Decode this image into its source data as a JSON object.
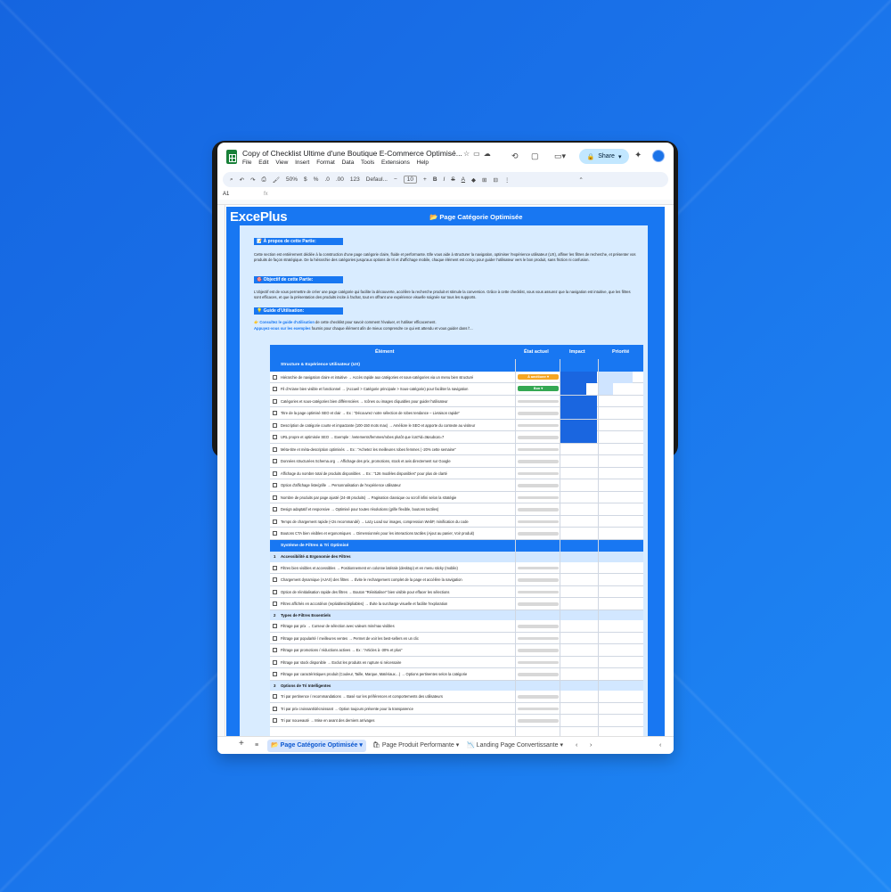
{
  "doc": {
    "title": "Copy of Checklist Ultime d'une Boutique E-Commerce Optimisé...",
    "menu": [
      "File",
      "Edit",
      "View",
      "Insert",
      "Format",
      "Data",
      "Tools",
      "Extensions",
      "Help"
    ],
    "share_label": "Share"
  },
  "toolbar": {
    "zoom": "50%",
    "currency": "$",
    "percent": "%",
    "dec_dec": ".0",
    "dec_inc": ".00",
    "number_format": "123",
    "font": "Defaul...",
    "font_size": "10",
    "bold": "B"
  },
  "formula_bar": {
    "cell": "A1",
    "fx": "fx"
  },
  "sheet": {
    "logo": "ExcePlus",
    "title": "📂 Page Catégorie Optimisée",
    "about_label": "📝 À propos de cette Partie:",
    "about_text": "Cette section est entièrement dédiée à la construction d'une page catégorie claire, fluide et performante. Elle vous aide à structurer la navigation, optimiser l'expérience utilisateur (UX), affiner les filtres de recherche, et présenter vos produits de façon stratégique. De la hiérarchie des catégories jusqu'aux options de tri et d'affichage mobile, chaque élément est conçu pour guider l'utilisateur vers le bon produit, sans friction ni confusion.",
    "objective_label": "🎯 Objectif de cette Partie:",
    "objective_text": "L'objectif est de vous permettre de créer une page catégorie qui facilite la découverte, accélère la recherche produit et stimule la conversion. Grâce à cette checklist, vous vous assurez que la navigation est intuitive, que les filtres sont efficaces, et que la présentation des produits incite à l'achat, tout en offrant une expérience visuelle soignée sur tous les supports.",
    "guide_label": "💡 Guide d'Utilisation:",
    "guide_line1_pre": "👉 ",
    "guide_line1_link": "Consultez le guide d'utilisation",
    "guide_line1_post": " de cette checklist pour savoir comment l'évaluer, et l'utiliser efficacement.",
    "guide_line2_link": "Appuyez-vous sur les exemples",
    "guide_line2_post": " fournis pour chaque élément afin de mieux comprendre ce qui est attendu et vous guider dans l'..."
  },
  "table": {
    "headers": {
      "element": "Élément",
      "etat": "État actuel",
      "impact": "Impact",
      "priorite": "Priorité"
    },
    "group1": "Structure & Expérience Utilisateur (UX)",
    "rows1": [
      {
        "text": "Hiérarchie de navigation claire et intuitive → Accès rapide aux catégories et sous-catégories via un menu bien structuré",
        "status": "À améliorer",
        "status_color": "#f5a623",
        "impact": 1.0,
        "priority": 0.95
      },
      {
        "text": "Fil d'Ariane bien visible et fonctionnel → (Accueil > Catégorie principale > Sous-catégorie) pour faciliter la navigation",
        "status": "Bon",
        "status_color": "#34a853",
        "impact": 0.7,
        "priority": 0.4
      },
      {
        "text": "Catégories et sous-catégories bien différenciées → Icônes ou images cliquables pour guider l'utilisateur",
        "status": "",
        "status_color": "",
        "impact": 1.0,
        "priority": 0
      },
      {
        "text": "Titre de la page optimisé SEO et clair → Ex : \"Découvrez notre sélection de robes tendance – Livraison rapide\"",
        "status": "",
        "status_color": "",
        "impact": 1.0,
        "priority": 0
      },
      {
        "text": "Description de catégorie courte et impactante (100-150 mots max) → Améliore le SEO et apporte du contexte au visiteur",
        "status": "",
        "status_color": "",
        "impact": 1.0,
        "priority": 0
      },
      {
        "text": "URL propre et optimisée SEO → Exemple : /vetements/femmes/robes plutôt que /cat?id=3&subcat=7",
        "status": "",
        "status_color": "",
        "impact": 1.0,
        "priority": 0
      },
      {
        "text": "Méta-titre et méta-description optimisés → Ex : \"Achetez les meilleures robes femmes | -20% cette semaine\"",
        "status": "",
        "status_color": "",
        "impact": 0,
        "priority": 0
      },
      {
        "text": "Données structurées Schema.org → Affichage des prix, promotions, stock et avis directement sur Google",
        "status": "",
        "status_color": "",
        "impact": 0,
        "priority": 0
      },
      {
        "text": "Affichage du nombre total de produits disponibles → Ex : \"126 modèles disponibles\" pour plus de clarté",
        "status": "",
        "status_color": "",
        "impact": 0,
        "priority": 0
      },
      {
        "text": "Option d'affichage liste/grille → Personnalisation de l'expérience utilisateur",
        "status": "",
        "status_color": "",
        "impact": 0,
        "priority": 0
      },
      {
        "text": "Nombre de produits par page ajusté (24-48 produits) → Pagination classique ou scroll infini selon la stratégie",
        "status": "",
        "status_color": "",
        "impact": 0,
        "priority": 0
      },
      {
        "text": "Design adaptatif et responsive → Optimisé pour toutes résolutions (grille flexible, boutons tactiles)",
        "status": "",
        "status_color": "",
        "impact": 0,
        "priority": 0
      },
      {
        "text": "Temps de chargement rapide (<2s recommandé) → Lazy Load sur images, compression WebP, minification du code",
        "status": "",
        "status_color": "",
        "impact": 0,
        "priority": 0
      },
      {
        "text": "Boutons CTA bien visibles et ergonomiques → Dimensionnés pour les interactions tactiles (Ajout au panier, Voir produit)",
        "status": "",
        "status_color": "",
        "impact": 0,
        "priority": 0
      }
    ],
    "group2": "Système de Filtres & Tri Optimisé",
    "sub1_num": "1",
    "sub1": "Accessibilité & Ergonomie des Filtres",
    "rows2": [
      "Filtres bien visibles et accessibles → Positionnement en colonne latérale (desktop) et en menu sticky (mobile)",
      "Chargement dynamique (AJAX) des filtres → Évite le rechargement complet de la page et accélère la navigation",
      "Option de réinitialisation rapide des filtres → Bouton \"Réinitialiser\" bien visible pour effacer les sélections",
      "Filtres affichés en accordéon (repliables/dépliables) → Évite la surcharge visuelle et facilite l'exploration"
    ],
    "sub2_num": "2",
    "sub2": "Types de Filtres Essentiels",
    "rows3": [
      "Filtrage par prix → Curseur de sélection avec valeurs min/max visibles",
      "Filtrage par popularité / meilleures ventes → Permet de voir les best-sellers en un clic",
      "Filtrage par promotions / réductions actives → Ex : \"Articles à -30% et plus\"",
      "Filtrage par stock disponible → Exclut les produits en rupture si nécessaire",
      "Filtrage par caractéristiques produit (Couleur, Taille, Marque, Matériaux…) → Options pertinentes selon la catégorie"
    ],
    "sub3_num": "3",
    "sub3": "Options de Tri Intelligentes",
    "rows4": [
      "Tri par pertinence / recommandations → Basé sur les préférences et comportements des utilisateurs",
      "Tri par prix croissant/décroissant → Option toujours présente pour la transparence",
      "Tri par nouveauté → Mise en avant des derniers arrivages"
    ],
    "impact_color": "#1a66e0",
    "priority_color": "#cfe4ff"
  },
  "tabs": [
    {
      "label": "Page Catégorie Optimisée",
      "icon": "📂",
      "active": true
    },
    {
      "label": "Page Produit Performante",
      "icon": "🛍",
      "active": false
    },
    {
      "label": "Landing Page Convertissante",
      "icon": "📉",
      "active": false
    }
  ]
}
